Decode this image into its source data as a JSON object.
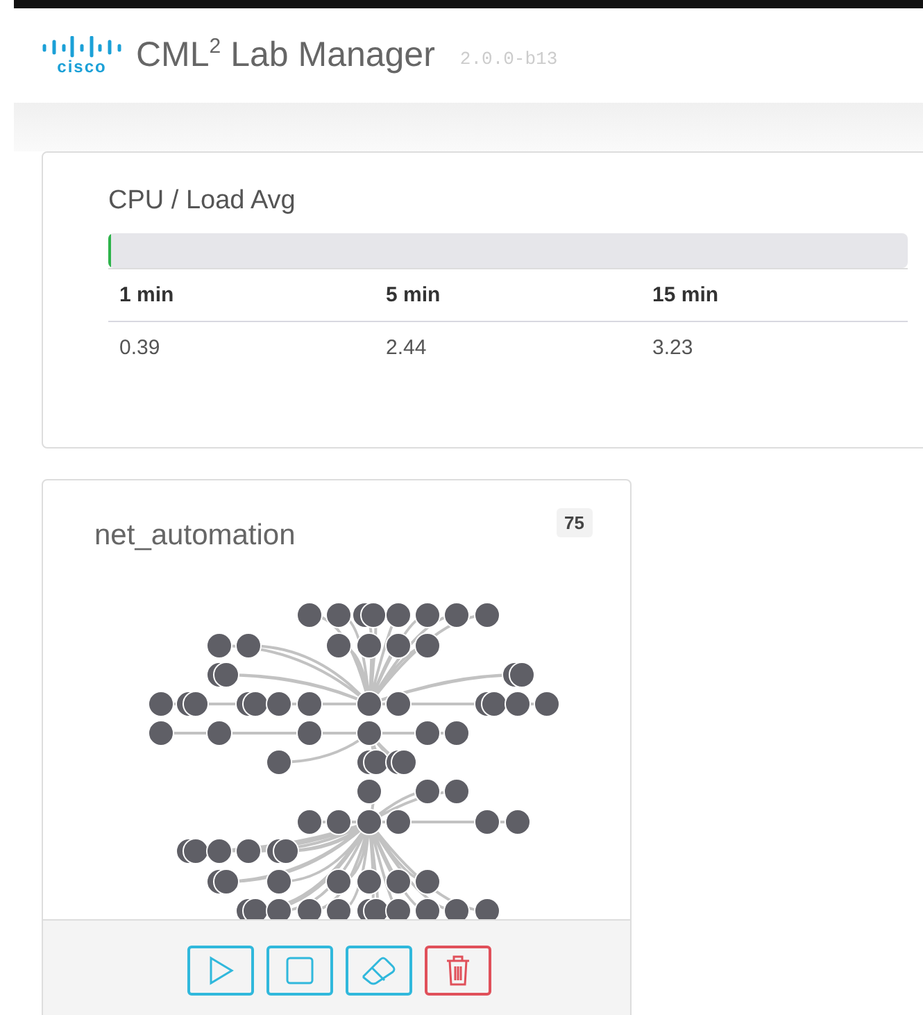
{
  "header": {
    "logo": "cisco",
    "title": "CML$^{2}$ Lab Manager",
    "version": "2.0.0-b13"
  },
  "cpu_card": {
    "title": "CPU / Load Avg",
    "level": 0.004,
    "columns": [
      "1 min",
      "5 min",
      "15 min"
    ],
    "values": [
      "0.39",
      "2.44",
      "3.23"
    ]
  },
  "lab_card": {
    "name": "net_automation",
    "node_count": "75",
    "actions": [
      {
        "kind": "start"
      },
      {
        "kind": "stop"
      },
      {
        "kind": "wipe"
      },
      {
        "kind": "delete"
      }
    ]
  }
}
